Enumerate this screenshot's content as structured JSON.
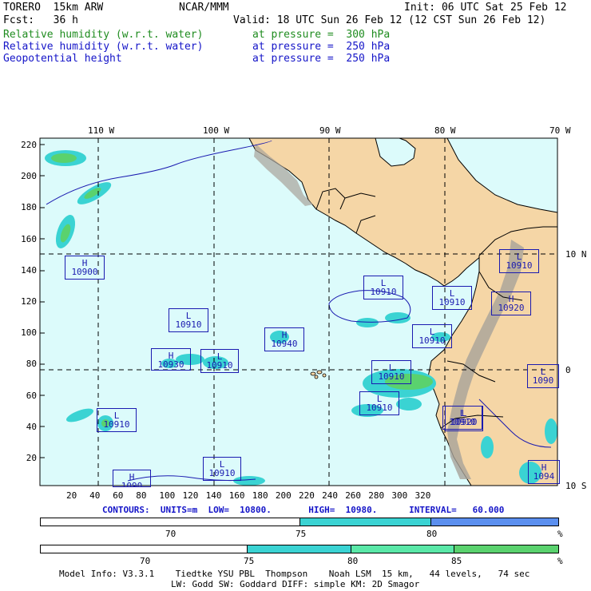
{
  "header": {
    "model": "TORERO  15km ARW",
    "org": "NCAR/MMM",
    "init": "Init: 06 UTC Sat 25 Feb 12",
    "fcst": "Fcst:   36 h",
    "valid": "Valid: 18 UTC Sun 26 Feb 12 (12 CST Sun 26 Feb 12)",
    "fields": [
      {
        "name": "Relative humidity (w.r.t. water)",
        "level": "at pressure =  300 hPa",
        "color": "#1f8c1f"
      },
      {
        "name": "Relative humidity (w.r.t. water)",
        "level": "at pressure =  250 hPa",
        "color": "#1515c8"
      },
      {
        "name": "Geopotential height",
        "level": "at pressure =  250 hPa",
        "color": "#1515c8"
      }
    ]
  },
  "map": {
    "lon_labels": [
      "110 W",
      "100 W",
      "90 W",
      "80 W",
      "70 W"
    ],
    "lat_labels": [
      "10 N",
      "0",
      "10 S"
    ],
    "x_ticks": [
      "20",
      "40",
      "60",
      "80",
      "100",
      "120",
      "140",
      "160",
      "180",
      "200",
      "220",
      "240",
      "260",
      "280",
      "300",
      "320"
    ],
    "y_ticks": [
      "220",
      "200",
      "180",
      "160",
      "140",
      "120",
      "100",
      "80",
      "60",
      "40",
      "20"
    ],
    "pressure_centers": [
      {
        "type": "H",
        "value": "10900"
      },
      {
        "type": "L",
        "value": "10910"
      },
      {
        "type": "H",
        "value": "10930"
      },
      {
        "type": "L",
        "value": "10910"
      },
      {
        "type": "H",
        "value": "10940"
      },
      {
        "type": "L",
        "value": "10910"
      },
      {
        "type": "L",
        "value": "10910"
      },
      {
        "type": "L",
        "value": "10910"
      },
      {
        "type": "L",
        "value": "10910"
      },
      {
        "type": "L",
        "value": "10910"
      },
      {
        "type": "H",
        "value": "10920"
      },
      {
        "type": "L",
        "value": "10910"
      },
      {
        "type": "L",
        "value": "10910"
      },
      {
        "type": "L",
        "value": "1090"
      },
      {
        "type": "L",
        "value": "10920"
      },
      {
        "type": "L",
        "value": "10910"
      },
      {
        "type": "H",
        "value": "1090"
      },
      {
        "type": "H",
        "value": "1094"
      },
      {
        "type": "L",
        "value": "10910"
      }
    ],
    "colors": {
      "ocean": "#dcfbfb",
      "land": "#f5d6a6",
      "terrain": "#a8a39a",
      "rh_green": "#5ad26e",
      "rh_cyan": "#3ad3d3",
      "rh_blue": "#5b8fef",
      "contour": "#1a1ab0"
    }
  },
  "contours": "CONTOURS:  UNITS=m  LOW=  10800.       HIGH=  10980.      INTERVAL=   60.000",
  "colorbars": [
    {
      "ticks": [
        "70",
        "75",
        "80"
      ],
      "unit": "%"
    },
    {
      "ticks": [
        "70",
        "75",
        "80",
        "85"
      ],
      "unit": "%"
    }
  ],
  "footer": {
    "line1": "Model Info: V3.3.1    Tiedtke YSU PBL  Thompson    Noah LSM  15 km,   44 levels,   74 sec",
    "line2": "LW: Godd SW: Goddard DIFF: simple KM: 2D Smagor"
  }
}
